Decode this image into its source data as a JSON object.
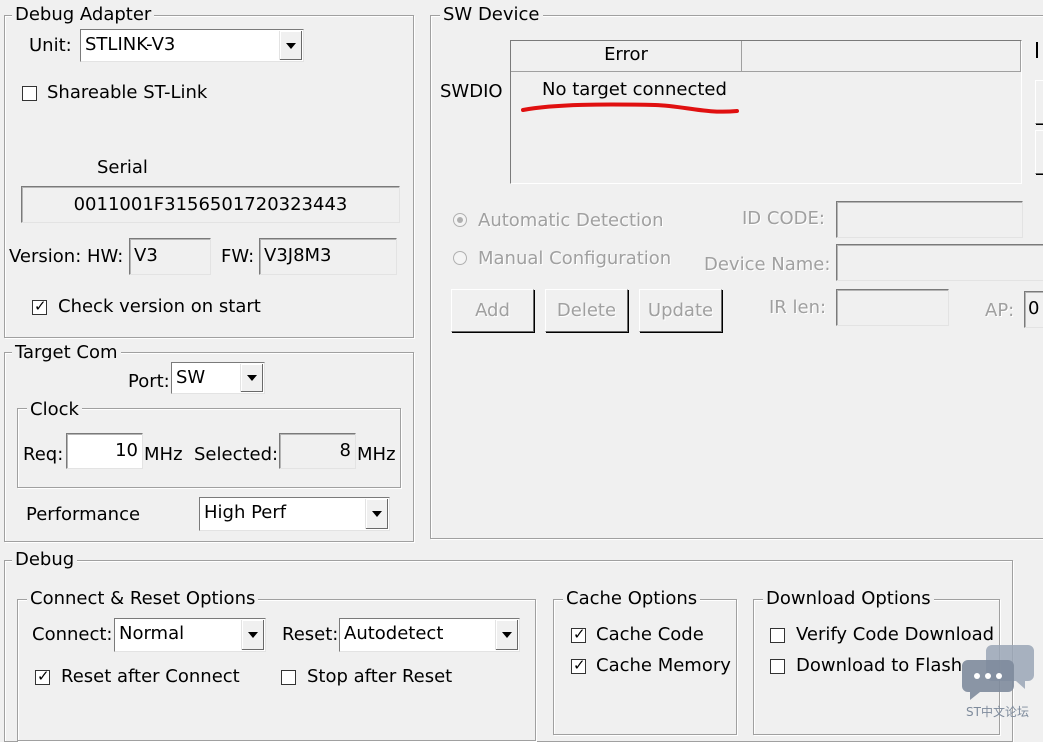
{
  "debug_adapter": {
    "legend": "Debug Adapter",
    "unit_label": "Unit:",
    "unit_value": "STLINK-V3",
    "shareable_label": "Shareable ST-Link",
    "shareable_checked": false,
    "serial_label": "Serial",
    "serial_value": "0011001F3156501720323443",
    "version_hw_label": "Version: HW:",
    "hw_value": "V3",
    "fw_label": "FW:",
    "fw_value": "V3J8M3",
    "check_version_label": "Check version on start",
    "check_version_checked": true
  },
  "sw_device": {
    "legend": "SW Device",
    "swdio_label": "SWDIO",
    "table_header": "Error",
    "table_row": "No target connected",
    "auto_detect_label": "Automatic Detection",
    "manual_config_label": "Manual Configuration",
    "id_code_label": "ID CODE:",
    "device_name_label": "Device Name:",
    "ir_len_label": "IR len:",
    "ap_label": "AP:",
    "ap_value": "0",
    "add_button": "Add",
    "delete_button": "Delete",
    "update_button": "Update",
    "annotation_color": "#e01010"
  },
  "target_com": {
    "legend": "Target Com",
    "port_label": "Port:",
    "port_value": "SW",
    "clock_legend": "Clock",
    "req_label": "Req:",
    "req_value": "10",
    "mhz1": "MHz",
    "selected_label": "Selected:",
    "selected_value": "8",
    "mhz2": "MHz",
    "performance_label": "Performance",
    "performance_value": "High Perf"
  },
  "debug": {
    "legend": "Debug",
    "connect_reset": {
      "legend": "Connect & Reset Options",
      "connect_label": "Connect:",
      "connect_value": "Normal",
      "reset_label": "Reset:",
      "reset_value": "Autodetect",
      "reset_after_connect_label": "Reset after Connect",
      "reset_after_connect_checked": true,
      "stop_after_reset_label": "Stop after Reset",
      "stop_after_reset_checked": false
    },
    "cache": {
      "legend": "Cache Options",
      "cache_code_label": "Cache Code",
      "cache_memory_label": "Cache Memory"
    },
    "download": {
      "legend": "Download Options",
      "verify_label": "Verify Code Download",
      "flash_label": "Download to Flash"
    }
  },
  "watermark": {
    "text": "ST中文论坛",
    "icon": "chat-bubbles-icon"
  }
}
